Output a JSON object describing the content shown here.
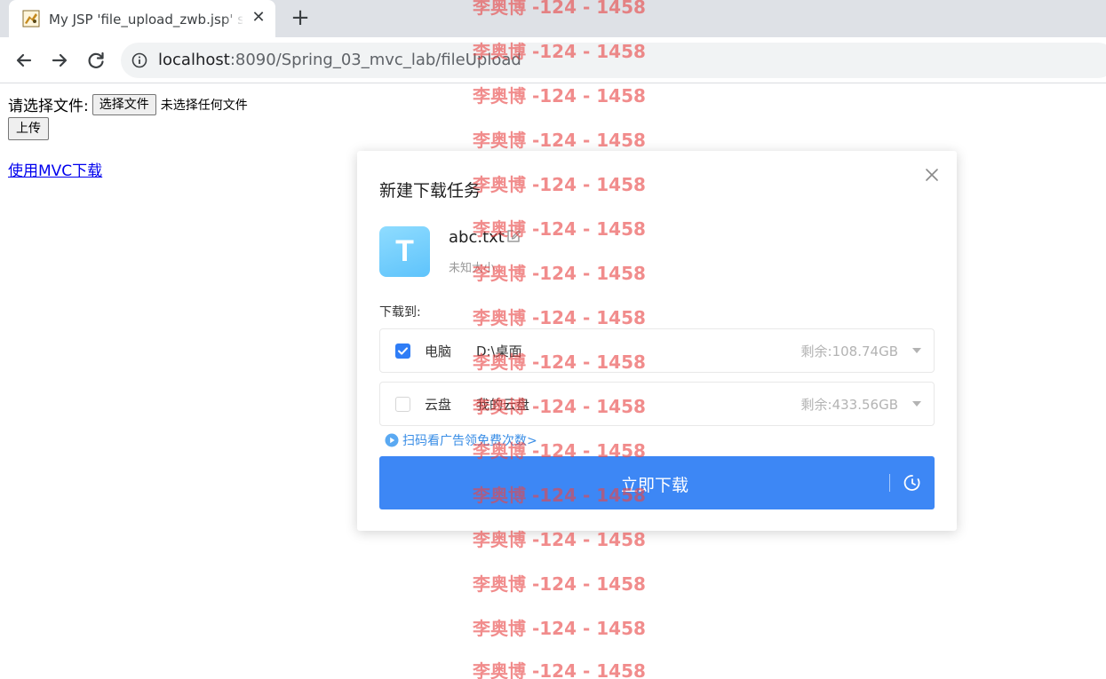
{
  "browser": {
    "tab_title": "My JSP 'file_upload_zwb.jsp' s",
    "tab_close": "✕",
    "new_tab": "+",
    "url_host": "localhost",
    "url_rest": ":8090/Spring_03_mvc_lab/fileUpload"
  },
  "page": {
    "file_label": "请选择文件:",
    "choose_file_button": "选择文件",
    "no_file_text": "未选择任何文件",
    "upload_button": "上传",
    "mvc_link": "使用MVC下载"
  },
  "dialog": {
    "title": "新建下载任务",
    "file_icon_letter": "T",
    "file_name": "abc.txt",
    "file_size": "未知大小",
    "save_to_label": "下载到:",
    "destinations": [
      {
        "name": "电脑",
        "path": "D:\\桌面",
        "free": "剩余:108.74GB",
        "checked": true
      },
      {
        "name": "云盘",
        "path": "我的云盘",
        "free": "剩余:433.56GB",
        "checked": false
      }
    ],
    "ad_text": "扫码看广告领免费次数>",
    "download_button": "立即下载",
    "accent_color": "#3d87f5"
  },
  "watermark": {
    "text": "李奥博 -124 - 1458",
    "color": "#e84646"
  }
}
